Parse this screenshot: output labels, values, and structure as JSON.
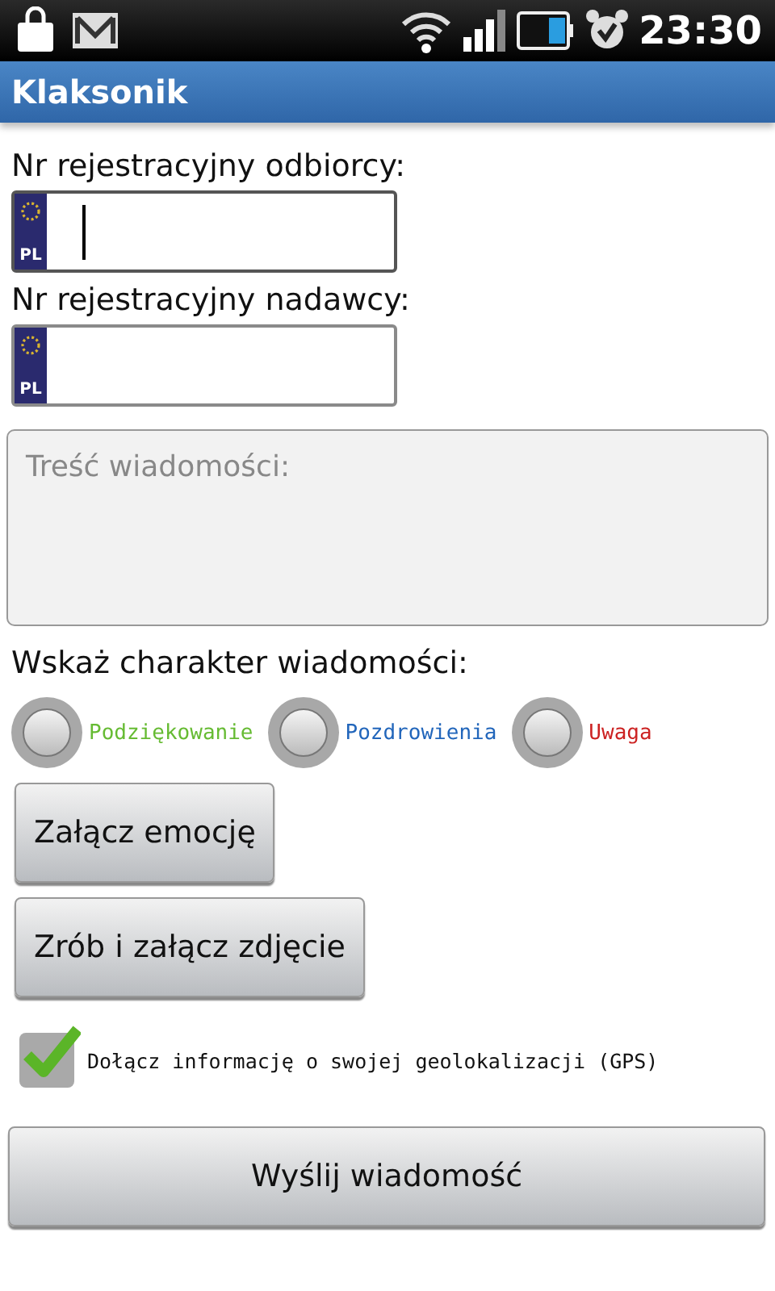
{
  "status_bar": {
    "time": "23:30"
  },
  "window": {
    "title": "Klaksonik"
  },
  "plate_fields": [
    {
      "label": "Nr rejestracyjny odbiorcy:",
      "country": "PL",
      "focused": true
    },
    {
      "label": "Nr rejestracyjny nadawcy:",
      "country": "PL",
      "focused": false
    }
  ],
  "message": {
    "placeholder": "Treść wiadomości:"
  },
  "type_label": "Wskaż charakter wiadomości:",
  "types": [
    {
      "label": "Podziękowanie",
      "color": "#66bb33",
      "selected": false
    },
    {
      "label": "Pozdrowienia",
      "color": "#2266bb",
      "selected": false
    },
    {
      "label": "Uwaga",
      "color": "#cc2222",
      "selected": false
    }
  ],
  "attach_buttons": [
    "Załącz emocję",
    "Zrób i załącz zdjęcie"
  ],
  "gps": {
    "label": "Dołącz informację o swojej geolokalizacji (GPS)",
    "checked": true
  },
  "send_button": "Wyślij wiadomość"
}
